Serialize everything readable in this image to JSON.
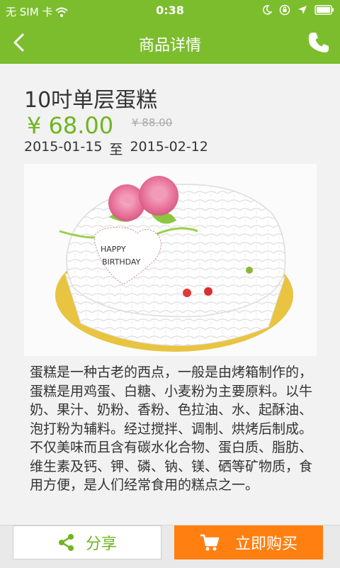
{
  "status": {
    "carrier": "无 SIM 卡",
    "time": "0:38"
  },
  "nav": {
    "title": "商品详情",
    "back_icon": "chevron-left-icon",
    "phone_icon": "phone-icon"
  },
  "product": {
    "name": "10吋单层蛋糕",
    "price": "¥ 68.00",
    "original_price": "¥ 88.00",
    "date_start": "2015-01-15",
    "date_sep": "至",
    "date_end": "2015-02-12",
    "cake_text_line1": "HAPPY",
    "cake_text_line2": "BIRTHDAY",
    "description": "蛋糕是一种古老的西点，一般是由烤箱制作的，蛋糕是用鸡蛋、白糖、小麦粉为主要原料。以牛奶、果汁、奶粉、香粉、色拉油、水、起酥油、泡打粉为辅料。经过搅拌、调制、烘烤后制成。不仅美味而且含有碳水化合物、蛋白质、脂肪、维生素及钙、钾、磷、钠、镁、硒等矿物质，食用方便，是人们经常食用的糕点之一。"
  },
  "bottom": {
    "share_label": "分享",
    "buy_label": "立即购买"
  },
  "colors": {
    "brand_green": "#7cbd2e",
    "price_green": "#6fb51f",
    "buy_orange": "#ff8010"
  }
}
